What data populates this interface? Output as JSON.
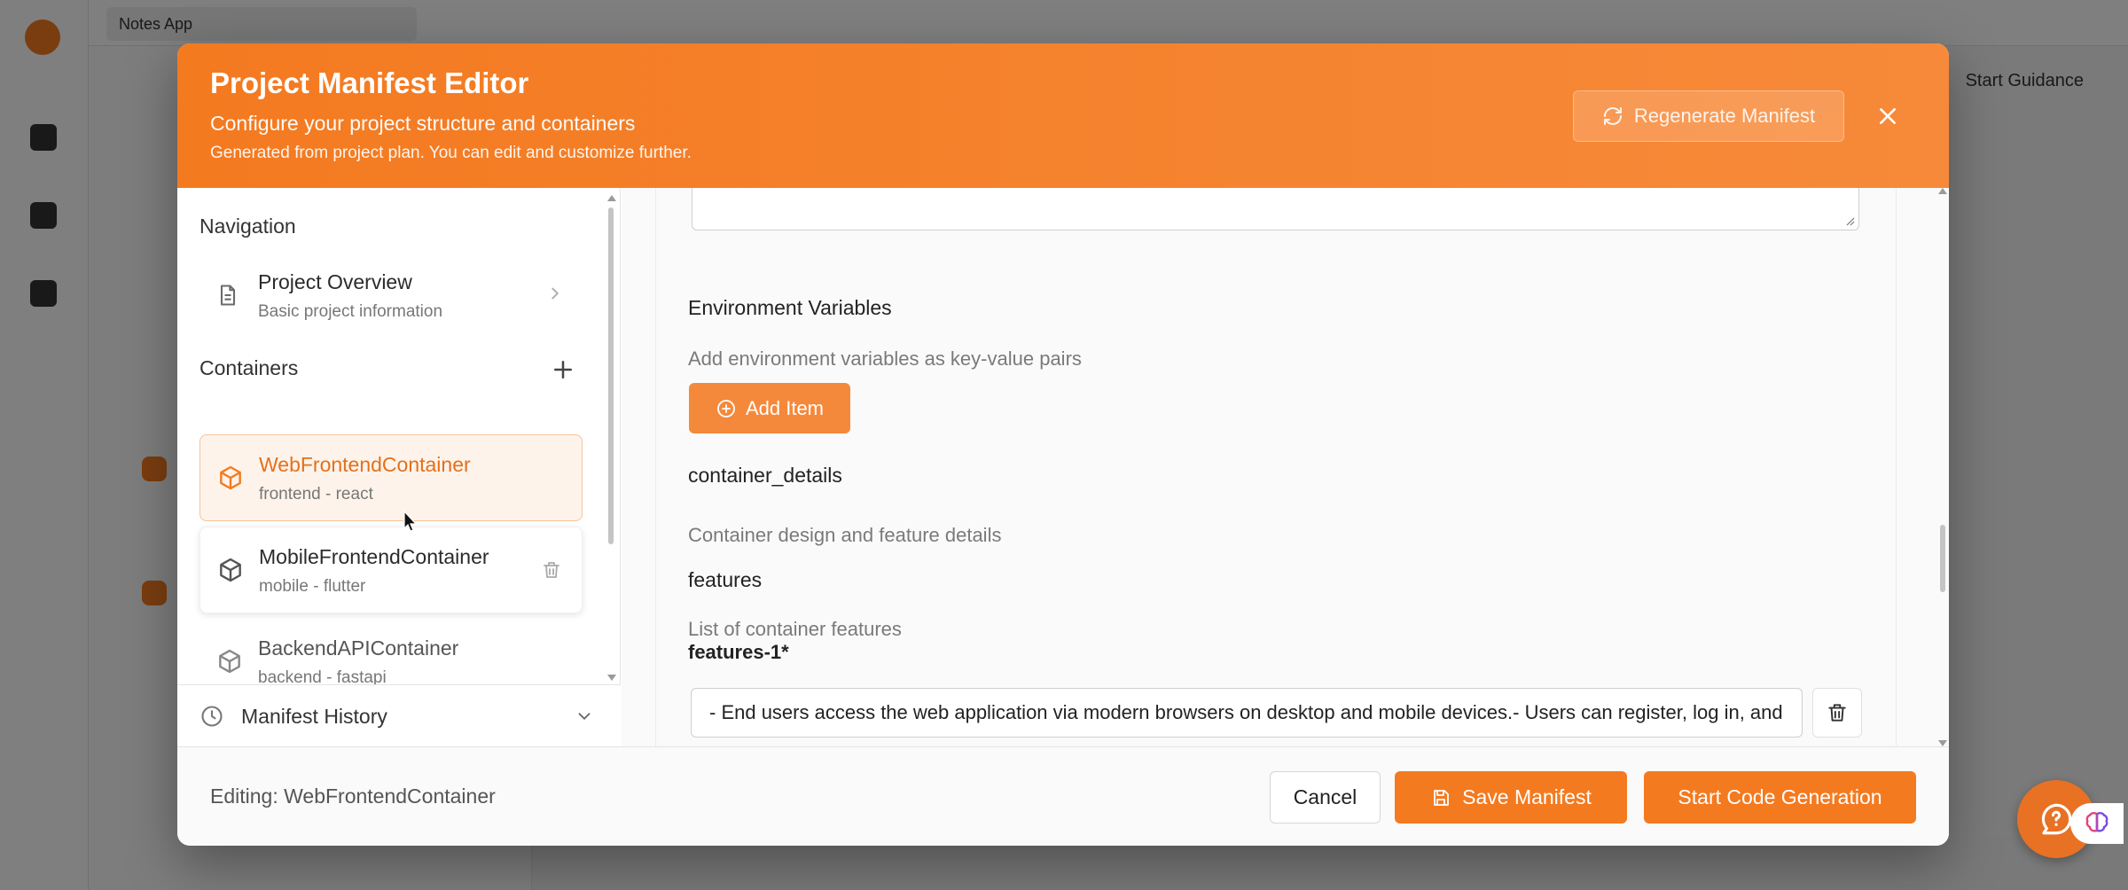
{
  "background": {
    "app_selector": "Notes App",
    "guidance_link": "Start Guidance"
  },
  "modal": {
    "title": "Project Manifest Editor",
    "subtitle": "Configure your project structure and containers",
    "note": "Generated from project plan. You can edit and customize further.",
    "regenerate_label": "Regenerate Manifest"
  },
  "sidebar": {
    "navigation_label": "Navigation",
    "overview": {
      "title": "Project Overview",
      "subtitle": "Basic project information"
    },
    "containers_label": "Containers",
    "containers": [
      {
        "title": "WebFrontendContainer",
        "subtitle": "frontend - react",
        "active": true
      },
      {
        "title": "MobileFrontendContainer",
        "subtitle": "mobile - flutter",
        "active": false
      },
      {
        "title": "BackendAPIContainer",
        "subtitle": "backend - fastapi",
        "active": false
      }
    ],
    "history_label": "Manifest History"
  },
  "main": {
    "env_label": "Environment Variables",
    "env_desc": "Add environment variables as key-value pairs",
    "add_item_label": "Add Item",
    "container_details_label": "container_details",
    "container_details_desc": "Container design and feature details",
    "features_label": "features",
    "features_desc": "List of container features",
    "feature_item_label": "features-1*",
    "feature_item_value": "- End users access the web application via modern browsers on desktop and mobile devices.- Users can register, log in, and manage their notes"
  },
  "footer": {
    "editing_text": "Editing: WebFrontendContainer",
    "cancel_label": "Cancel",
    "save_label": "Save Manifest",
    "start_label": "Start Code Generation"
  },
  "colors": {
    "brand_orange": "#f47a20",
    "active_bg": "#fef3ea"
  },
  "icons": [
    "refresh-icon",
    "close-icon",
    "document-icon",
    "chevron-right-icon",
    "plus-icon",
    "cube-icon",
    "trash-icon",
    "clock-icon",
    "chevron-down-icon",
    "plus-circle-icon",
    "save-icon",
    "help-chat-icon",
    "brain-icon"
  ]
}
